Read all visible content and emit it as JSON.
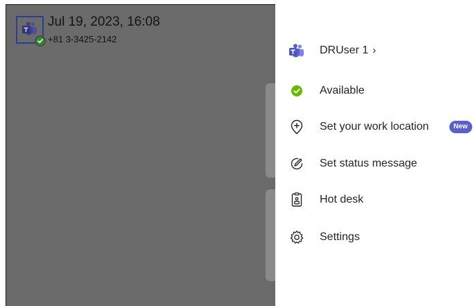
{
  "header": {
    "datetime": "Jul 19, 2023, 16:08",
    "phone": "+81 3-3425-2142",
    "avatar_icon": "teams-logo-icon",
    "presence_icon": "available-check-icon"
  },
  "panel": {
    "user": {
      "name": "DRUser 1",
      "chevron": "›",
      "icon": "teams-logo-icon"
    },
    "items": [
      {
        "label": "Available",
        "icon": "available-check-icon"
      },
      {
        "label": "Set your work location",
        "icon": "location-plus-icon",
        "badge": "New"
      },
      {
        "label": "Set status message",
        "icon": "pencil-circle-icon"
      },
      {
        "label": "Hot desk",
        "icon": "hot-desk-icon"
      },
      {
        "label": "Settings",
        "icon": "gear-icon"
      }
    ]
  },
  "colors": {
    "teams_purple": "#5b5fc7",
    "presence_green": "#6bb700",
    "overlay": "#6b6b6b"
  }
}
